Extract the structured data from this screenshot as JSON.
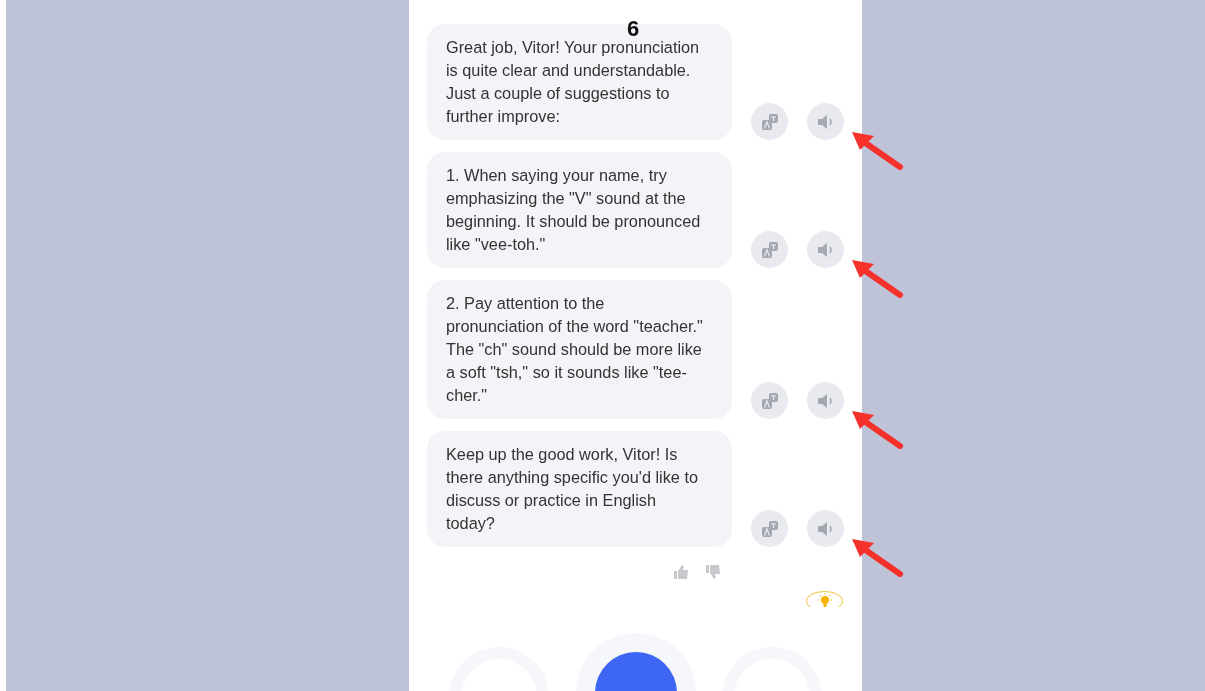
{
  "annotation": {
    "label": "6"
  },
  "messages": [
    {
      "text": "Great job, Vitor! Your pronunciation is quite clear and understandable. Just a couple of suggestions to further improve:",
      "highlighted": true
    },
    {
      "text": "1. When saying your name, try emphasizing the \"V\" sound at the beginning. It should be pronounced like \"vee-toh.\"",
      "highlighted": true
    },
    {
      "text": "2. Pay attention to the pronunciation of the word \"teacher.\" The \"ch\" sound should be more like a soft \"tsh,\" so it sounds like \"tee-cher.\"",
      "highlighted": true
    },
    {
      "text": "Keep up the good work, Vitor! Is there anything specific you'd like to discuss or practice in English today?",
      "highlighted": true
    }
  ],
  "feedback": {
    "liked": false,
    "disliked": false
  }
}
